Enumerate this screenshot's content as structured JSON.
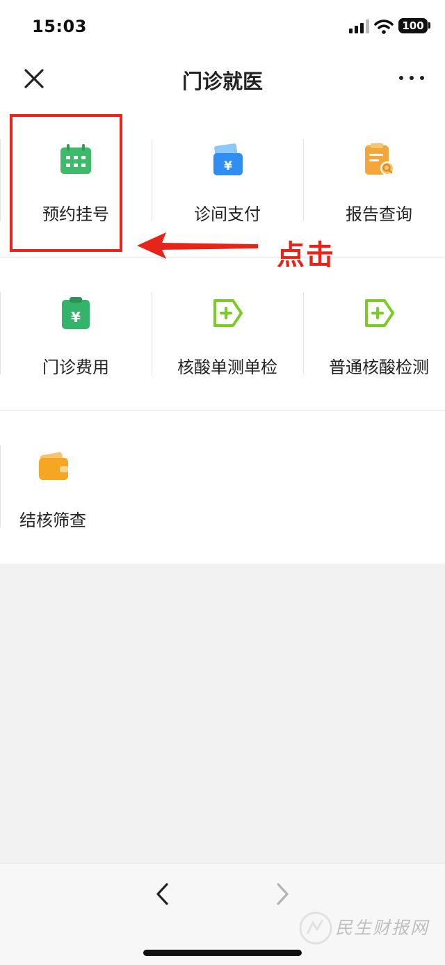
{
  "status_bar": {
    "time": "15:03",
    "battery": "100"
  },
  "nav": {
    "title": "门诊就医"
  },
  "services": [
    {
      "label": "预约挂号",
      "icon": "calendar-icon",
      "color": "#3dbb6a"
    },
    {
      "label": "诊间支付",
      "icon": "wallet-payment-icon",
      "color": "#2f8ef0"
    },
    {
      "label": "报告查询",
      "icon": "report-search-icon",
      "color": "#f3a73b"
    },
    {
      "label": "门诊费用",
      "icon": "clipboard-yuan-icon",
      "color": "#34b36a"
    },
    {
      "label": "核酸单测单检",
      "icon": "test-tag-icon",
      "color": "#7acb26"
    },
    {
      "label": "普通核酸检测",
      "icon": "test-tag-icon",
      "color": "#7acb26"
    },
    {
      "label": "结核筛查",
      "icon": "wallet-icon",
      "color": "#f5a623"
    }
  ],
  "annotation": {
    "text": "点击",
    "color": "#e62418"
  },
  "watermark": {
    "text": "民生财报网"
  }
}
